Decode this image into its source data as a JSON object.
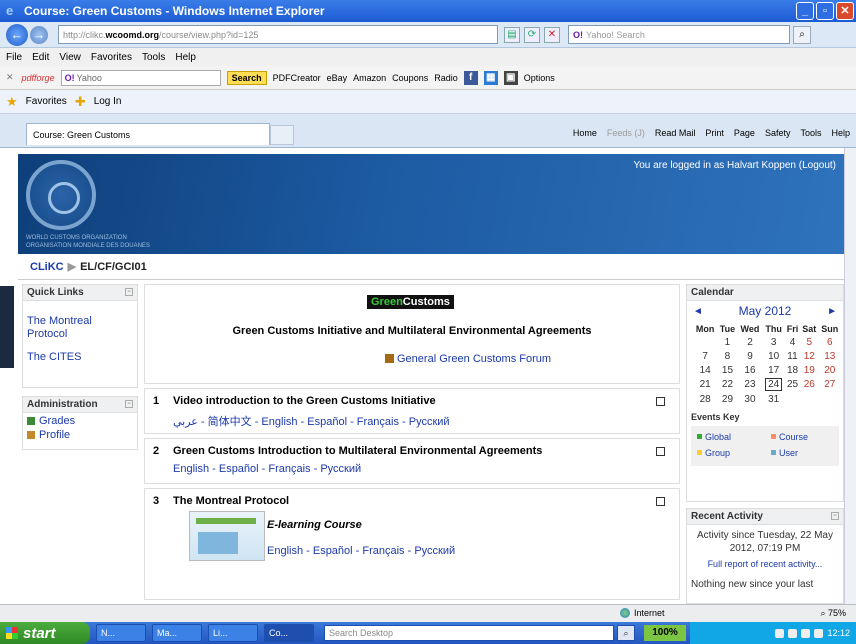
{
  "window": {
    "title": "Course: Green Customs - Windows Internet Explorer"
  },
  "address": {
    "url_prefix": "http://clikc.",
    "url_domain": "wcoomd.org",
    "url_suffix": "/course/view.php?id=125",
    "search_placeholder": "Yahoo! Search"
  },
  "menu": [
    "File",
    "Edit",
    "View",
    "Favorites",
    "Tools",
    "Help"
  ],
  "toolbar": {
    "pdfforge": "pdfforge",
    "yahoo_box": "Yahoo",
    "search": "Search",
    "items": [
      "PDFCreator",
      "eBay",
      "Amazon",
      "Coupons",
      "Radio"
    ],
    "options": "Options"
  },
  "favorites": {
    "label": "Favorites",
    "login": "Log In"
  },
  "tab": {
    "label": "Course: Green Customs"
  },
  "commandbar": {
    "home": "Home",
    "feeds": "Feeds (J)",
    "readmail": "Read Mail",
    "print": "Print",
    "page": "Page",
    "safety": "Safety",
    "tools": "Tools",
    "help": "Help"
  },
  "header": {
    "wco_line1": "WORLD CUSTOMS ORGANIZATION",
    "wco_line2": "ORGANISATION MONDIALE DES DOUANES",
    "login_text": "You are logged in as Halvart Koppen (Logout)"
  },
  "breadcrumb": {
    "root": "CLiKC",
    "current": "EL/CF/GCI01"
  },
  "quick_links": {
    "title": "Quick Links",
    "items": [
      "The Montreal Protocol",
      "The CITES"
    ]
  },
  "admin": {
    "title": "Administration",
    "items": [
      "Grades",
      "Profile"
    ]
  },
  "intro": {
    "logo_green": "Green",
    "logo_white": "Customs",
    "title": "Green Customs Initiative and Multilateral Environmental Agreements",
    "forum": "General Green Customs Forum"
  },
  "sections": [
    {
      "num": "1",
      "title": "Video introduction to the Green Customs Initiative",
      "languages": "عربي - 简体中文 - English - Español - Français - Русский"
    },
    {
      "num": "2",
      "title": "Green Customs Introduction to Multilateral Environmental Agreements",
      "languages": "English - Español - Français - Русский"
    },
    {
      "num": "3",
      "title": "The Montreal Protocol",
      "course_label": "E-learning Course",
      "languages": "English - Español - Français - Русский"
    }
  ],
  "calendar": {
    "title": "Calendar",
    "month": "May 2012",
    "days": [
      "Mon",
      "Tue",
      "Wed",
      "Thu",
      "Fri",
      "Sat",
      "Sun"
    ],
    "weeks": [
      [
        "",
        "1",
        "2",
        "3",
        "4",
        "5",
        "6"
      ],
      [
        "7",
        "8",
        "9",
        "10",
        "11",
        "12",
        "13"
      ],
      [
        "14",
        "15",
        "16",
        "17",
        "18",
        "19",
        "20"
      ],
      [
        "21",
        "22",
        "23",
        "24",
        "25",
        "26",
        "27"
      ],
      [
        "28",
        "29",
        "30",
        "31",
        "",
        "",
        ""
      ]
    ],
    "today": "24",
    "events_key": "Events Key",
    "keys": [
      "Global",
      "Course",
      "Group",
      "User"
    ],
    "key_colors": [
      "#33aa33",
      "#ff8c66",
      "#ffcc33",
      "#66aacc"
    ]
  },
  "recent": {
    "title": "Recent Activity",
    "since": "Activity since Tuesday, 22 May 2012, 07:19 PM",
    "full_report": "Full report of recent activity...",
    "nothing": "Nothing new since your last"
  },
  "status": {
    "zone": "Internet",
    "zoom": "75%"
  },
  "taskbar": {
    "start": "start",
    "tasks": [
      "N...",
      "Ma...",
      "Li...",
      "Co..."
    ],
    "search_placeholder": "Search Desktop",
    "battery": "100%",
    "clock": "12:12"
  }
}
